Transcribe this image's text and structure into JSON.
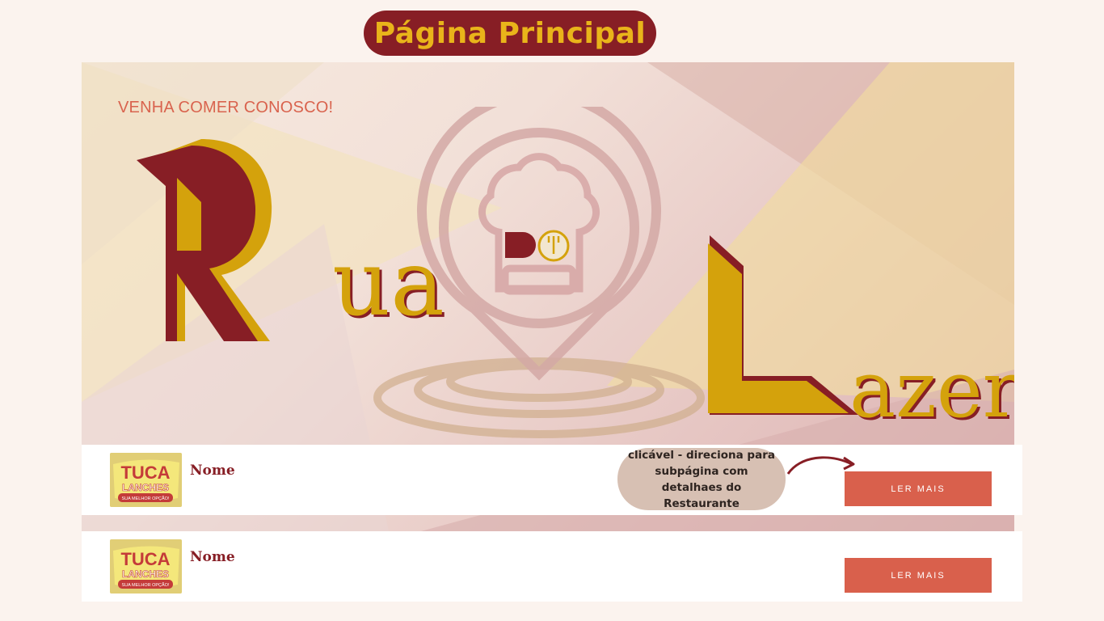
{
  "header": {
    "title": "Página Principal"
  },
  "hero": {
    "tagline": "VENHA COMER CONOSCO!",
    "logo_word_1": "ua",
    "logo_word_2": "azer",
    "logo_letter_1": "R",
    "logo_letter_2": "L",
    "center_emblem_text": "D"
  },
  "colors": {
    "brand_red": "#871e25",
    "brand_gold": "#d4a20c",
    "accent_orange": "#d9604c",
    "bubble": "#d7c0b3",
    "background": "#fbf3ee"
  },
  "restaurants": [
    {
      "name": "Nome",
      "button_label": "LER MAIS",
      "thumb_text_1": "TUCA",
      "thumb_text_2": "LANCHES",
      "thumb_text_3": "SUA MELHOR OPÇÃO!"
    },
    {
      "name": "Nome",
      "button_label": "LER MAIS",
      "thumb_text_1": "TUCA",
      "thumb_text_2": "LANCHES",
      "thumb_text_3": "SUA MELHOR OPÇÃO!"
    }
  ],
  "annotation": {
    "text": "clicável - direciona para subpágina com detalhaes do Restaurante",
    "arrow_icon": "curved-arrow-right"
  }
}
